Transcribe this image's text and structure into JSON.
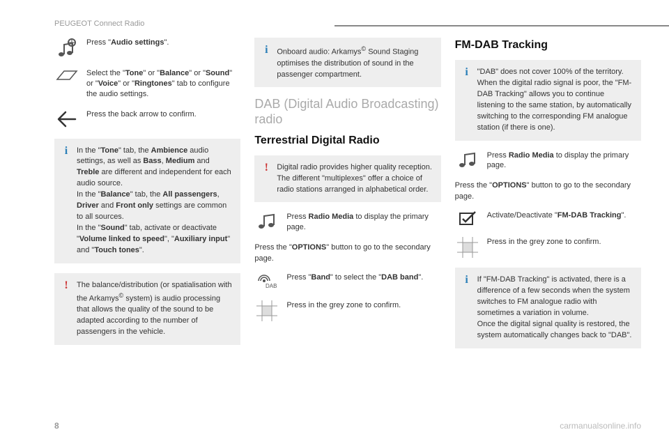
{
  "header": "PEUGEOT Connect Radio",
  "pageNumber": "8",
  "watermark": "carmanualsonline.info",
  "col1": {
    "step1": {
      "pre": "Press \"",
      "bold": "Audio settings",
      "post": "\"."
    },
    "step2": "Select the \"<b>Tone</b>\" or \"<b>Balance</b>\" or \"<b>Sound</b>\" or \"<b>Voice</b>\" or \"<b>Ringtones</b>\" tab to configure the audio settings.",
    "step3": "Press the back arrow to confirm.",
    "info1": "In the \"<b>Tone</b>\" tab, the <b>Ambience</b> audio settings, as well as <b>Bass</b>, <b>Medium</b> and <b>Treble</b> are different and independent for each audio source.<br>In the \"<b>Balance</b>\" tab, the <b>All passengers</b>, <b>Driver</b> and <b>Front only</b> settings are common to all sources.<br>In the \"<b>Sound</b>\" tab, activate or deactivate \"<b>Volume linked to speed</b>\", \"<b>Auxiliary input</b>\" and \"<b>Touch tones</b>\".",
    "warn1": "The balance/distribution (or spatialisation with the Arkamys<sup>©</sup> system) is audio processing that allows the quality of the sound to be adapted according to the number of passengers in the vehicle."
  },
  "col2": {
    "info1": "Onboard audio: Arkamys<sup>©</sup> Sound Staging optimises the distribution of sound in the passenger compartment.",
    "h2": "DAB (Digital Audio Broadcasting) radio",
    "h3": "Terrestrial Digital Radio",
    "warn1": "Digital radio provides higher quality reception.<br>The different \"multiplexes\" offer a choice of radio stations arranged in alphabetical order.",
    "step1": "Press <b>Radio Media</b> to display the primary page.",
    "body1": "Press the \"<b>OPTIONS</b>\" button to go to the secondary page.",
    "step2": "Press \"<b>Band</b>\" to select the \"<b>DAB band</b>\".",
    "step3": "Press in the grey zone to confirm."
  },
  "col3": {
    "h3": "FM-DAB Tracking",
    "info1": "\"DAB\" does not cover 100% of the territory.<br>When the digital radio signal is poor, the \"FM-DAB Tracking\" allows you to continue listening to the same station, by automatically switching to the corresponding FM analogue station (if there is one).",
    "step1": "Press <b>Radio Media</b> to display the primary page.",
    "body1": "Press the \"<b>OPTIONS</b>\" button to go to the secondary page.",
    "step2": "Activate/Deactivate \"<b>FM-DAB Tracking</b>\".",
    "step3": "Press in the grey zone to confirm.",
    "info2": "If \"FM-DAB Tracking\" is activated, there is a difference of a few seconds when the system switches to FM analogue radio with sometimes a variation in volume.<br>Once the digital signal quality is restored, the system automatically changes back to \"DAB\"."
  }
}
